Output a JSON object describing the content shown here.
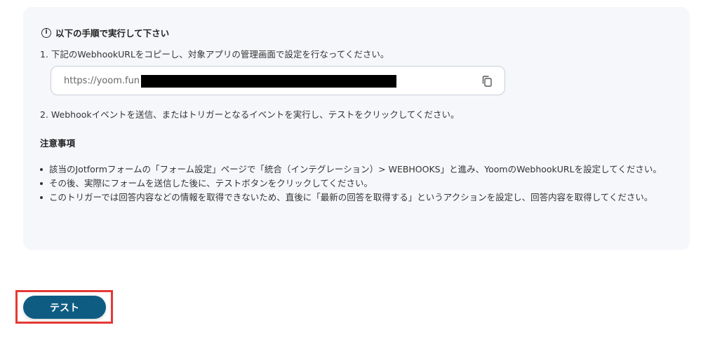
{
  "instructions": {
    "header": "以下の手順で実行して下さい",
    "info_icon_glyph": "i",
    "step1": "1. 下記のWebhookURLをコピーし、対象アプリの管理画面で設定を行なってください。",
    "webhook_url_visible": "https://yoom.fun",
    "step2": "2. Webhookイベントを送信、またはトリガーとなるイベントを実行し、テストをクリックしてください。"
  },
  "notes": {
    "title": "注意事項",
    "items": [
      "該当のJotformフォームの「フォーム設定」ページで「統合（インテグレーション）> WEBHOOKS」と進み、YoomのWebhookURLを設定してください。",
      "その後、実際にフォームを送信した後に、テストボタンをクリックしてください。",
      "このトリガーでは回答内容などの情報を取得できないため、直後に「最新の回答を取得する」というアクションを設定し、回答内容を取得してください。"
    ]
  },
  "actions": {
    "test_label": "テスト"
  },
  "colors": {
    "panel_bg": "#f5f7fa",
    "button_bg": "#0f5c82",
    "highlight_border": "#e53935"
  }
}
